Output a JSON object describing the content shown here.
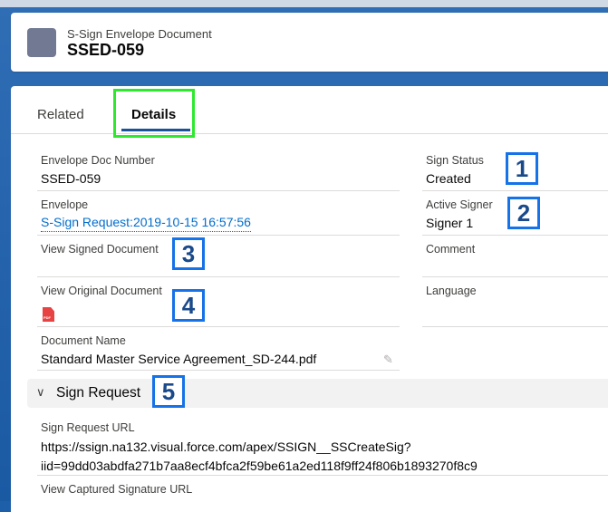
{
  "header": {
    "object_type": "S-Sign Envelope Document",
    "record_title": "SSED-059"
  },
  "tabs": [
    {
      "label": "Related",
      "active": false
    },
    {
      "label": "Details",
      "active": true
    }
  ],
  "fields": {
    "envelope_doc_number": {
      "label": "Envelope Doc Number",
      "value": "SSED-059"
    },
    "sign_status": {
      "label": "Sign Status",
      "value": "Created"
    },
    "envelope": {
      "label": "Envelope",
      "value": "S-Sign Request:2019-10-15 16:57:56"
    },
    "active_signer": {
      "label": "Active Signer",
      "value": "Signer 1"
    },
    "view_signed_document": {
      "label": "View Signed Document",
      "value": ""
    },
    "comment": {
      "label": "Comment",
      "value": ""
    },
    "view_original_document": {
      "label": "View Original Document",
      "icon": "pdf-file-icon",
      "icon_text": "PDF"
    },
    "language": {
      "label": "Language",
      "value": ""
    },
    "document_name": {
      "label": "Document Name",
      "value": "Standard Master Service Agreement_SD-244.pdf"
    }
  },
  "section": {
    "title": "Sign Request",
    "sign_request_url": {
      "label": "Sign Request URL",
      "line1": "https://ssign.na132.visual.force.com/apex/SSIGN__SSCreateSig?",
      "line2": "iid=99dd03abdfa271b7aa8ecf4bfca2f59be61a2ed118f9ff24f806b1893270f8c9"
    },
    "view_captured_signature_url": {
      "label": "View Captured Signature URL"
    }
  },
  "annotations": [
    "1",
    "2",
    "3",
    "4",
    "5"
  ],
  "colors": {
    "accent": "#1b5297",
    "link": "#006dcc",
    "highlight_box": "#2ee82e",
    "annotation_border": "#1572e8",
    "pdf_icon": "#e84343",
    "object_icon": "#727a93"
  }
}
